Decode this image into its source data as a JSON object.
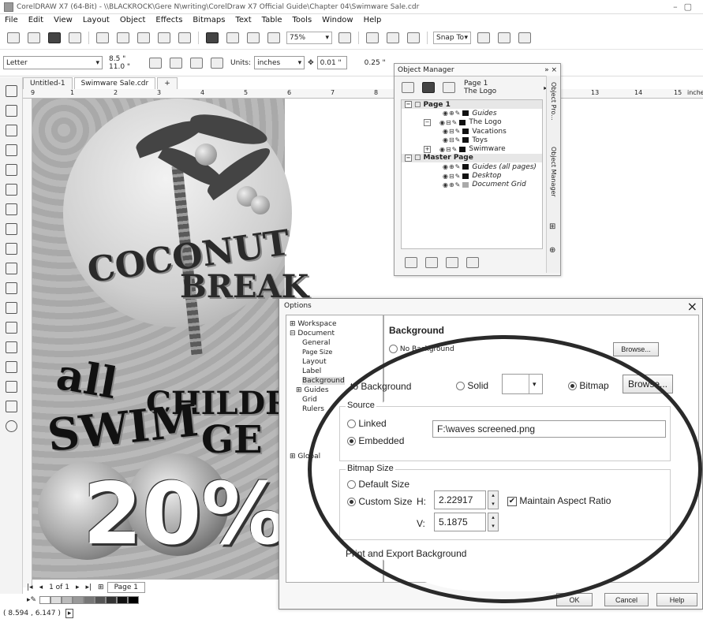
{
  "window": {
    "title": "CorelDRAW X7 (64-Bit) - \\\\BLACKROCK\\Gere N\\writing\\CorelDraw X7 Official Guide\\Chapter 04\\Swimware Sale.cdr"
  },
  "menu": [
    "File",
    "Edit",
    "View",
    "Layout",
    "Object",
    "Effects",
    "Bitmaps",
    "Text",
    "Table",
    "Tools",
    "Window",
    "Help"
  ],
  "toolbar": {
    "zoom": "75%",
    "snap_to": "Snap To"
  },
  "propbar": {
    "page_size": "Letter",
    "width": "8.5 \"",
    "height": "11.0 \"",
    "units_label": "Units:",
    "units": "inches",
    "nudge": "0.01 \"",
    "dup": "0.25 \""
  },
  "doc_tabs": [
    "Untitled-1",
    "Swimware Sale.cdr",
    "+"
  ],
  "ruler": {
    "marks": [
      "9",
      "1",
      "2",
      "3",
      "4",
      "5",
      "6",
      "7",
      "8",
      "13",
      "14",
      "15"
    ],
    "unit": "inches"
  },
  "artwork": {
    "line1": "COCONUT",
    "line2": "BREAK",
    "line3": "all",
    "line4": "CHILDRE",
    "line5": "SWIM",
    "line6": "GE",
    "big": "20%"
  },
  "object_manager": {
    "title": "Object Manager",
    "current_page": "Page 1",
    "current_layer": "The Logo",
    "tree": [
      {
        "label": "Page 1",
        "type": "page"
      },
      {
        "label": "Guides",
        "type": "layer",
        "italic": true
      },
      {
        "label": "The Logo",
        "type": "layer"
      },
      {
        "label": "Vacations",
        "type": "layer"
      },
      {
        "label": "Toys",
        "type": "layer"
      },
      {
        "label": "Swimware",
        "type": "layer"
      },
      {
        "label": "Master Page",
        "type": "page"
      },
      {
        "label": "Guides (all pages)",
        "type": "layer",
        "italic": true
      },
      {
        "label": "Desktop",
        "type": "layer",
        "italic": true
      },
      {
        "label": "Document Grid",
        "type": "layer",
        "italic": true
      }
    ],
    "side_tabs": [
      "Object Pro...",
      "Object Manager"
    ]
  },
  "options_dialog": {
    "title": "Options",
    "tree": [
      "Workspace",
      "Document",
      "General",
      "Page Size",
      "Layout",
      "Label",
      "Background",
      "Guides",
      "Grid",
      "Rulers",
      "Global"
    ],
    "section_title": "Background",
    "no_background": "No Background",
    "browse_top": "Browse...",
    "solid": "Solid",
    "bitmap": "Bitmap",
    "browse": "Browse...",
    "source_label": "Source",
    "linked": "Linked",
    "embedded": "Embedded",
    "file_path": "F:\\waves screened.png",
    "bitmap_size_label": "Bitmap Size",
    "default_size": "Default Size",
    "custom_size": "Custom Size",
    "h_label": "H:",
    "h_value": "2.22917",
    "v_label": "V:",
    "v_value": "5.1875",
    "maintain_aspect": "Maintain Aspect Ratio",
    "print_export": "Print and Export Background",
    "ok": "OK",
    "cancel": "Cancel",
    "help": "Help"
  },
  "page_nav": {
    "position": "1 of 1",
    "page_tab": "Page 1"
  },
  "status": {
    "coords": "( 8.594 , 6.147 )"
  }
}
